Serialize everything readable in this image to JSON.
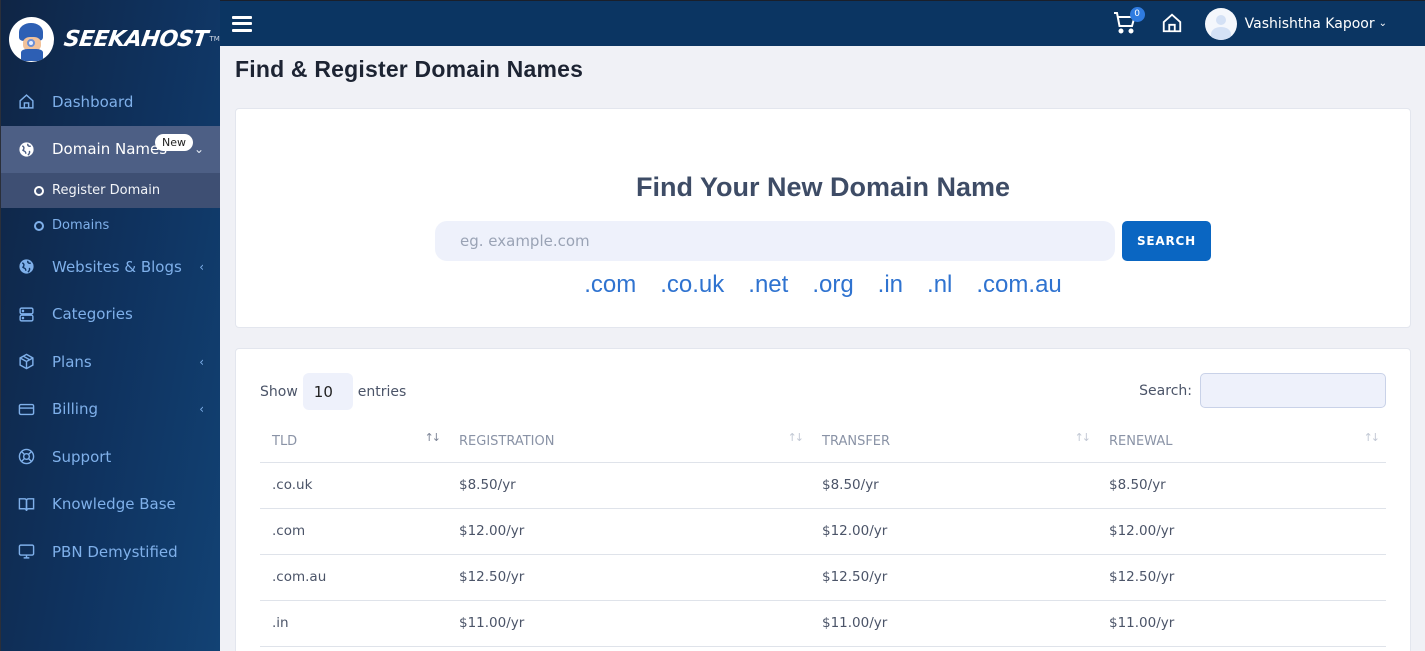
{
  "brand": {
    "name": "SEEKAHOST",
    "tm": "TM"
  },
  "sidebar": {
    "items": [
      {
        "label": "Dashboard",
        "icon": "home-icon"
      },
      {
        "label": "Domain Names",
        "icon": "globe-icon",
        "badge": "New",
        "chevron": "⌄",
        "active": true,
        "children": [
          {
            "label": "Register Domain",
            "active": true
          },
          {
            "label": "Domains"
          }
        ]
      },
      {
        "label": "Websites & Blogs",
        "icon": "globe-icon",
        "chevron": "‹"
      },
      {
        "label": "Categories",
        "icon": "server-icon"
      },
      {
        "label": "Plans",
        "icon": "box-icon",
        "chevron": "‹"
      },
      {
        "label": "Billing",
        "icon": "credit-card-icon",
        "chevron": "‹"
      },
      {
        "label": "Support",
        "icon": "lifebuoy-icon"
      },
      {
        "label": "Knowledge Base",
        "icon": "book-icon"
      },
      {
        "label": "PBN Demystified",
        "icon": "monitor-icon"
      }
    ]
  },
  "topbar": {
    "cart_count": "0",
    "user_name": "Vashishtha Kapoor",
    "user_chevron": "⌄"
  },
  "page": {
    "title": "Find & Register Domain Names"
  },
  "search_card": {
    "heading": "Find Your New Domain Name",
    "input_placeholder": "eg. example.com",
    "input_value": "",
    "button_label": "SEARCH",
    "tlds": [
      ".com",
      ".co.uk",
      ".net",
      ".org",
      ".in",
      ".nl",
      ".com.au"
    ]
  },
  "table_card": {
    "show_label": "Show",
    "entries_value": "10",
    "entries_label": "entries",
    "search_label": "Search:",
    "search_value": "",
    "columns": [
      "TLD",
      "REGISTRATION",
      "TRANSFER",
      "RENEWAL"
    ],
    "sort_glyph": "↑↓",
    "rows": [
      {
        "tld": ".co.uk",
        "registration": "$8.50/yr",
        "transfer": "$8.50/yr",
        "renewal": "$8.50/yr"
      },
      {
        "tld": ".com",
        "registration": "$12.00/yr",
        "transfer": "$12.00/yr",
        "renewal": "$12.00/yr"
      },
      {
        "tld": ".com.au",
        "registration": "$12.50/yr",
        "transfer": "$12.50/yr",
        "renewal": "$12.50/yr"
      },
      {
        "tld": ".in",
        "registration": "$11.00/yr",
        "transfer": "$11.00/yr",
        "renewal": "$11.00/yr"
      }
    ]
  },
  "colors": {
    "sidebar_bg": "#0f3360",
    "topbar_bg": "#0b3562",
    "accent": "#0a66c2",
    "link": "#2f73d0",
    "sidebar_text": "#7fb0ea"
  }
}
